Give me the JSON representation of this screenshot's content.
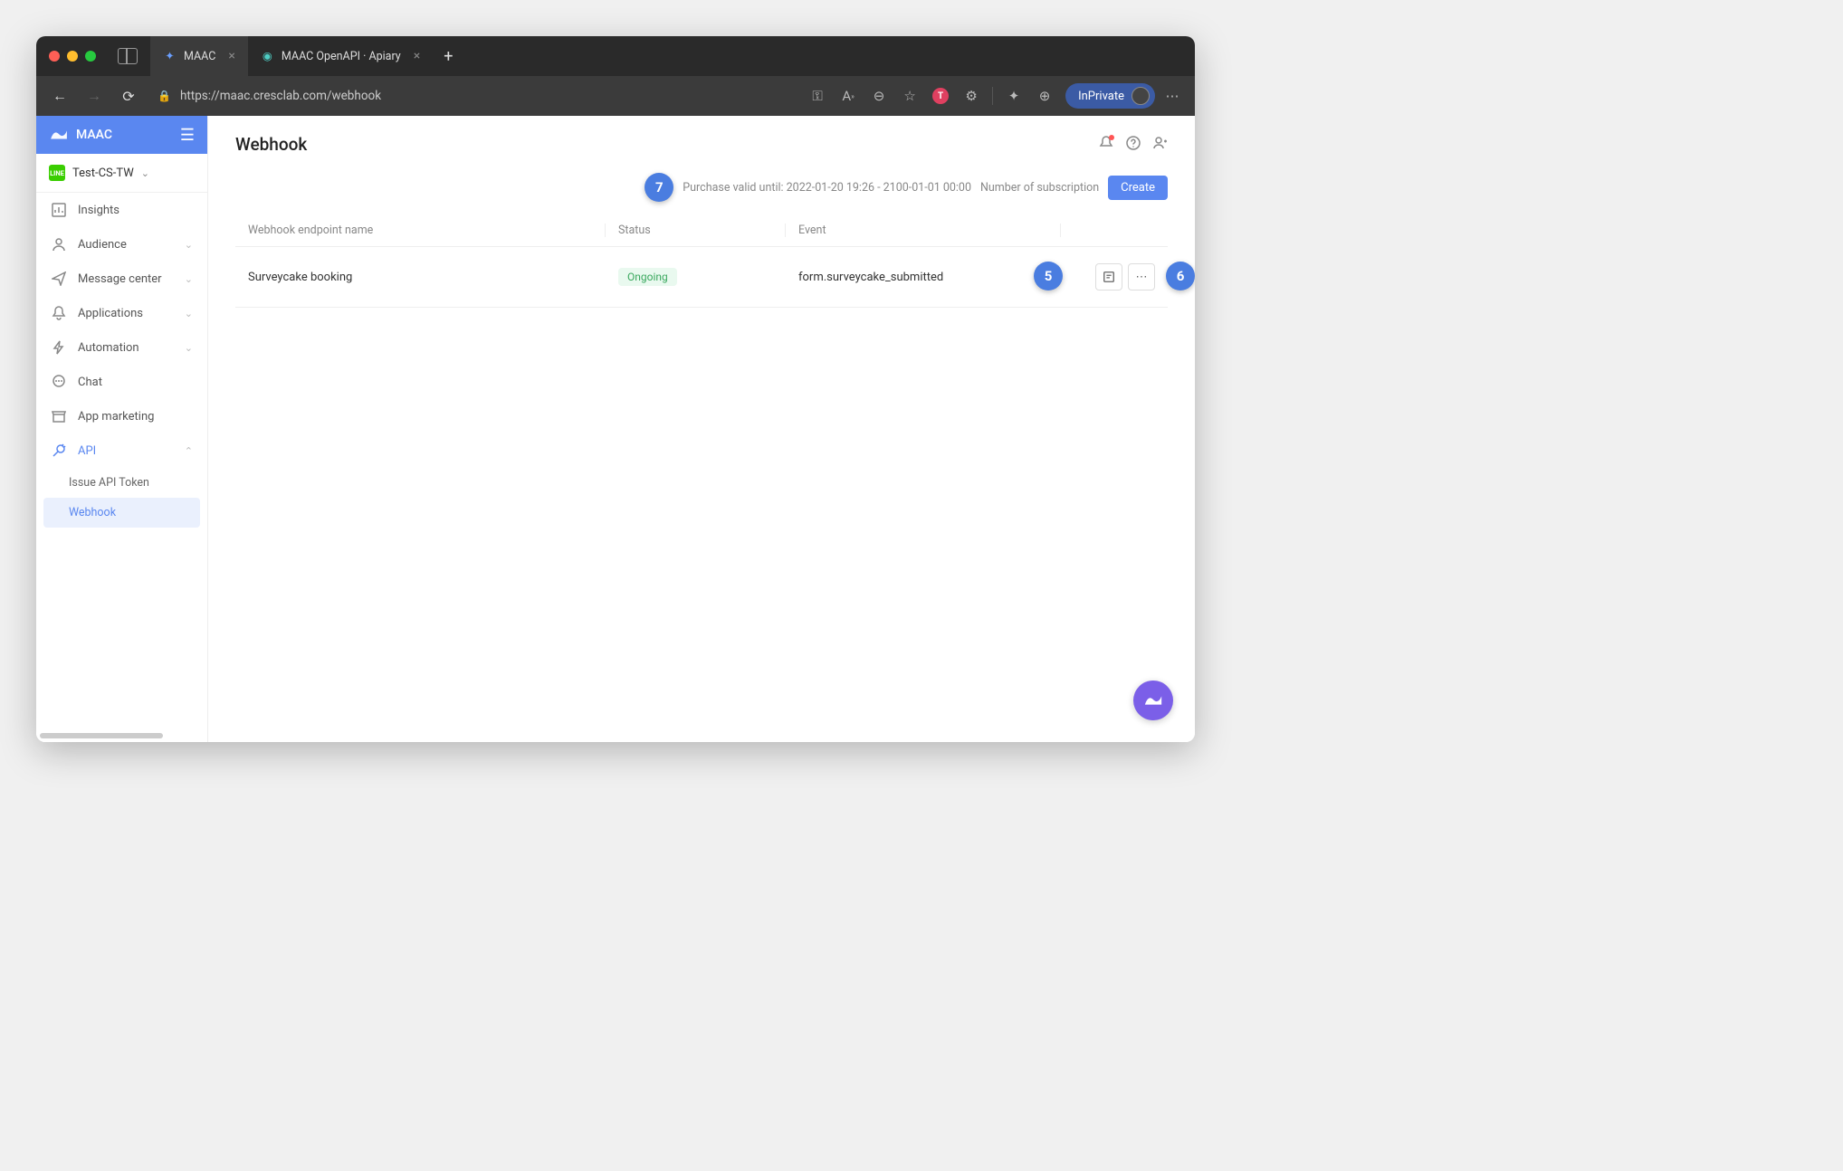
{
  "browser": {
    "tabs": [
      {
        "title": "MAAC",
        "active": true
      },
      {
        "title": "MAAC OpenAPI · Apiary",
        "active": false
      }
    ],
    "url": "https://maac.cresclab.com/webhook",
    "inprivate_label": "InPrivate"
  },
  "sidebar": {
    "app_name": "MAAC",
    "org_label": "Test-CS-TW",
    "items": [
      {
        "label": "Insights",
        "icon": "chart-bar",
        "expandable": false
      },
      {
        "label": "Audience",
        "icon": "user",
        "expandable": true
      },
      {
        "label": "Message center",
        "icon": "send",
        "expandable": true
      },
      {
        "label": "Applications",
        "icon": "bell",
        "expandable": true
      },
      {
        "label": "Automation",
        "icon": "bolt",
        "expandable": true
      },
      {
        "label": "Chat",
        "icon": "chat",
        "expandable": false
      },
      {
        "label": "App marketing",
        "icon": "store",
        "expandable": false
      },
      {
        "label": "API",
        "icon": "socket",
        "expandable": true,
        "active": true,
        "expanded": true
      }
    ],
    "api_subitems": [
      {
        "label": "Issue API Token",
        "active": false
      },
      {
        "label": "Webhook",
        "active": true
      }
    ]
  },
  "page": {
    "title": "Webhook",
    "purchase_info": "Purchase valid until: 2022-01-20 19:26 - 2100-01-01 00:00",
    "subscription_label": "Number of subscription",
    "create_label": "Create",
    "table": {
      "headers": {
        "name": "Webhook endpoint name",
        "status": "Status",
        "event": "Event"
      },
      "rows": [
        {
          "name": "Surveycake booking",
          "status": "Ongoing",
          "event": "form.surveycake_submitted"
        }
      ]
    }
  },
  "annotations": {
    "a5": "5",
    "a6": "6",
    "a7": "7"
  }
}
